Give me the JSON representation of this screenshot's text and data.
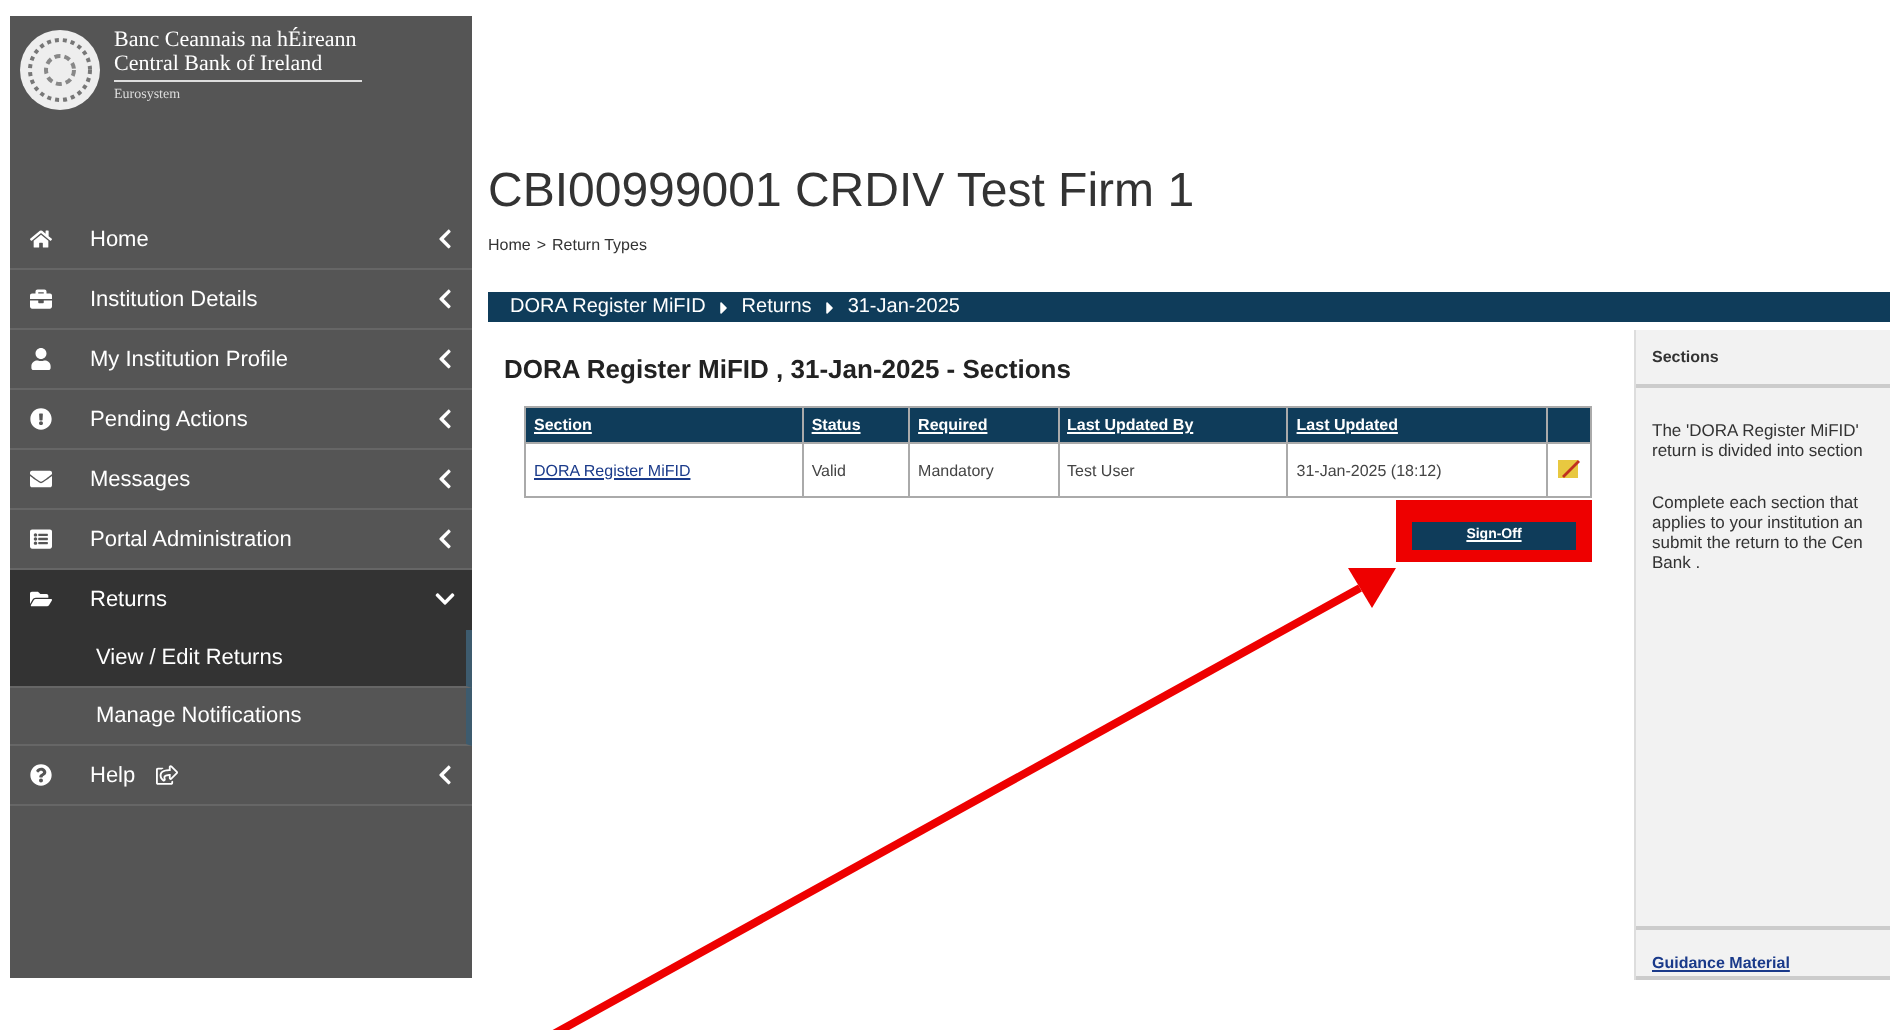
{
  "brand": {
    "name_irish": "Banc Ceannais na hÉireann",
    "name_english": "Central Bank of Ireland",
    "subtitle": "Eurosystem"
  },
  "sidebar": {
    "items": [
      {
        "label": "Home",
        "expanded": false
      },
      {
        "label": "Institution Details",
        "expanded": false
      },
      {
        "label": "My Institution Profile",
        "expanded": false
      },
      {
        "label": "Pending Actions",
        "expanded": false
      },
      {
        "label": "Messages",
        "expanded": false
      },
      {
        "label": "Portal Administration",
        "expanded": false
      },
      {
        "label": "Returns",
        "expanded": true,
        "children": [
          {
            "label": "View / Edit Returns",
            "selected": true
          },
          {
            "label": "Manage Notifications",
            "selected": false
          }
        ]
      },
      {
        "label": "Help",
        "expanded": false,
        "external": true
      }
    ]
  },
  "page": {
    "title": "CBI00999001 CRDIV Test Firm 1",
    "breadcrumb": [
      "Home",
      "Return Types"
    ],
    "breadcrumb_separator": ">"
  },
  "path_bar": [
    "DORA Register MiFID",
    "Returns",
    "31-Jan-2025"
  ],
  "sections": {
    "heading": "DORA Register MiFID , 31-Jan-2025 - Sections",
    "columns": [
      "Section",
      "Status",
      "Required",
      "Last Updated By",
      "Last Updated"
    ],
    "rows": [
      {
        "section": "DORA Register MiFID",
        "status": "Valid",
        "required": "Mandatory",
        "updated_by": "Test User",
        "updated": "31-Jan-2025 (18:12)"
      }
    ],
    "sign_off": "Sign-Off",
    "sign_off_highlighted": true
  },
  "info_panel": {
    "title": "Sections",
    "paragraphs": [
      [
        "The 'DORA Register MiFID'",
        "return is divided into section"
      ],
      [
        "Complete each section that",
        "applies to your institution an",
        "submit the return to the Cen",
        "Bank ."
      ]
    ],
    "link": "Guidance Material"
  }
}
